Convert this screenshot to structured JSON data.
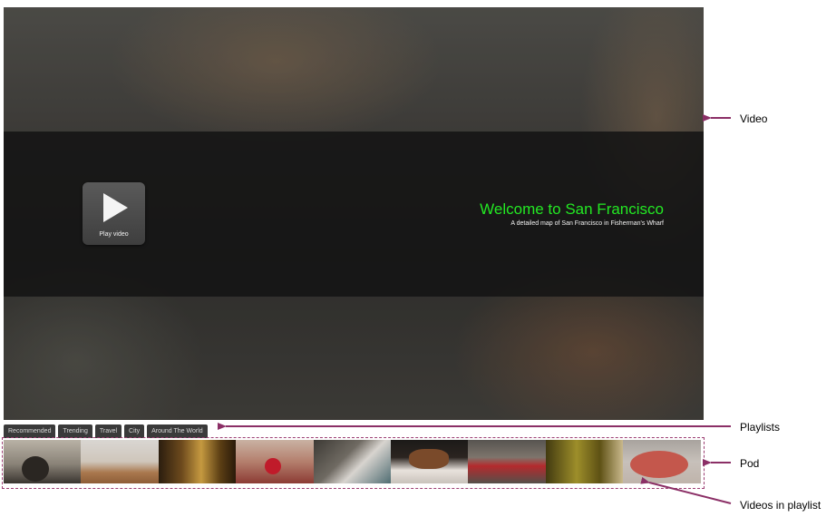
{
  "video": {
    "title": "Welcome to San Francisco",
    "subtitle": "A  detailed map of San Francisco in Fisherman's Wharf",
    "play_label": "Play video",
    "title_color": "#23e823"
  },
  "playlists": {
    "tabs": [
      {
        "label": "Recommended"
      },
      {
        "label": "Trending"
      },
      {
        "label": "Travel"
      },
      {
        "label": "City"
      },
      {
        "label": "Around The World"
      }
    ]
  },
  "pod": {
    "thumbnails": [
      {
        "subject": "coffee-maker"
      },
      {
        "subject": "pastries"
      },
      {
        "subject": "beer-glass"
      },
      {
        "subject": "cherries"
      },
      {
        "subject": "chef-cooking"
      },
      {
        "subject": "pancakes"
      },
      {
        "subject": "cook-red-apron"
      },
      {
        "subject": "kitchen-lights"
      },
      {
        "subject": "pizza"
      }
    ]
  },
  "annotations": {
    "video": "Video",
    "playlists": "Playlists",
    "pod": "Pod",
    "videos_in_playlist": "Videos in playlist",
    "color": "#8b2f66"
  }
}
